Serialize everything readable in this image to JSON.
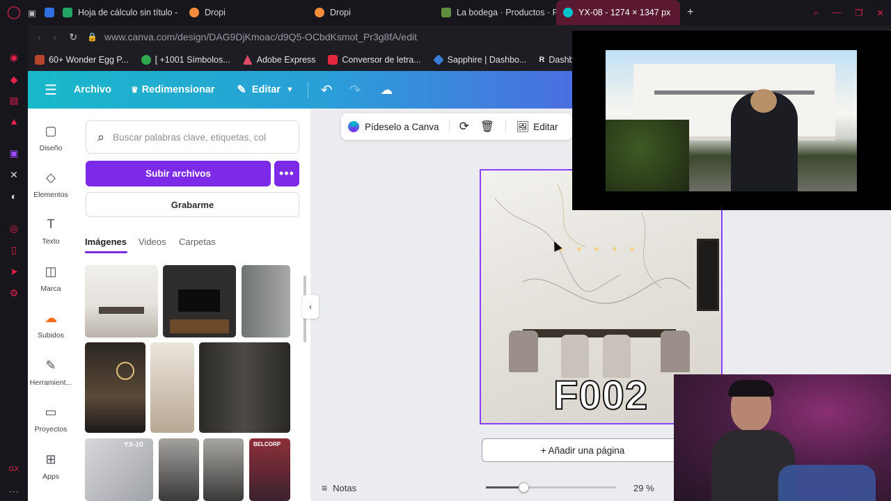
{
  "browser": {
    "tabs": [
      {
        "title": "Hoja de cálculo sin título -",
        "color": "#23a566"
      },
      {
        "title": "Dropi",
        "color": "#f28c3a"
      },
      {
        "title": "Dropi",
        "color": "#f28c3a"
      },
      {
        "title": "La bodega · Productos · Pe",
        "color": "#5e8e3e"
      },
      {
        "title": "YX-08 - 1274 × 1347 px",
        "color": "#00c4cc",
        "active": true
      }
    ],
    "new_tab": "+",
    "url": "www.canva.com/design/DAG9DjKmoac/d9Q5-OCbdKsmot_Pr3g8fA/edit",
    "bookmarks": [
      {
        "label": "60+ Wonder Egg P...",
        "color": "#b5452d"
      },
      {
        "label": "[ +1001 Símbolos...",
        "color": "#2fa84f"
      },
      {
        "label": "Adobe Express",
        "color": "#e24a6c"
      },
      {
        "label": "Conversor de letra...",
        "color": "#e3273f"
      },
      {
        "label": "Sapphire | Dashbo...",
        "color": "#3a7bd5"
      },
      {
        "label": "Dashboard",
        "color": "#ffffff"
      }
    ]
  },
  "canva": {
    "header": {
      "menu_icon": "hamburger-icon",
      "archivo": "Archivo",
      "redimensionar": "Redimensionar",
      "editar": "Editar"
    },
    "rail": [
      {
        "label": "Diseño",
        "icon": "layout-icon"
      },
      {
        "label": "Elementos",
        "icon": "shapes-icon"
      },
      {
        "label": "Texto",
        "icon": "text-icon"
      },
      {
        "label": "Marca",
        "icon": "brand-icon"
      },
      {
        "label": "Subidos",
        "icon": "cloud-upload-icon"
      },
      {
        "label": "Herramient...",
        "icon": "tools-icon"
      },
      {
        "label": "Proyectos",
        "icon": "folder-icon"
      },
      {
        "label": "Apps",
        "icon": "apps-icon"
      }
    ],
    "panel": {
      "search_placeholder": "Buscar palabras clave, etiquetas, col",
      "upload": "Subir archivos",
      "more": "•••",
      "record": "Grabarme",
      "tabs": [
        "Imágenes",
        "Videos",
        "Carpetas"
      ],
      "thumb_label": "YX-10",
      "thumb_label_2": "BELCORP"
    },
    "toolbar": {
      "ask": "Pídeselo a Canva",
      "edit": "Editar"
    },
    "page": {
      "overlay_text": "F002"
    },
    "add_page": "+ Añadir una página",
    "footer": {
      "notes": "Notas",
      "zoom": "29 %",
      "zoom_level": 0.29
    }
  }
}
